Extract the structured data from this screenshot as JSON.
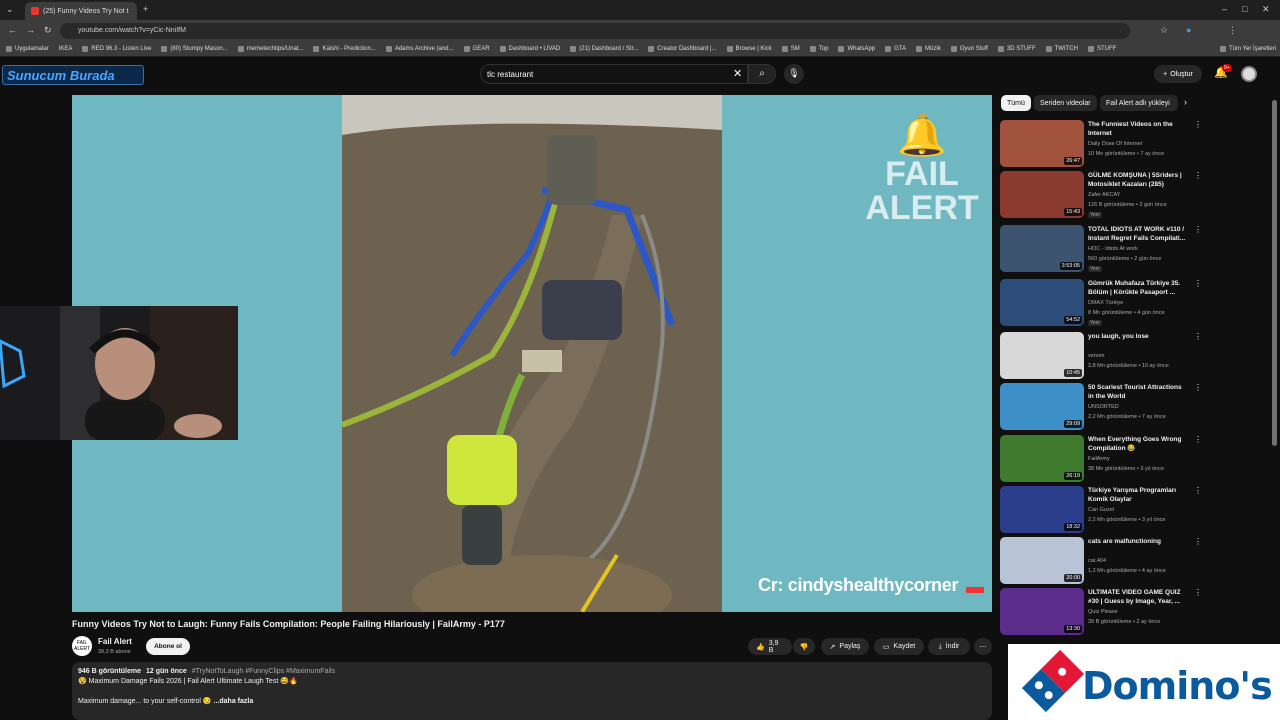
{
  "browser": {
    "tab_title": "(25) Funny Videos Try Not t",
    "url": "youtube.com/watch?v=yCic-NniIfM",
    "bookmarks": [
      "Uygulamalar",
      "IKEA",
      "RED 96.3 - Listen Live",
      "(80) Stumpy Mason...",
      "memetechtips/Unat...",
      "Kaishi - Prediction...",
      "Adams Archive (and...",
      "GEAR",
      "Dashboard • LIVAD",
      "(21) Dashboard / Str...",
      "Creator Dashboard |...",
      "Browse | Kick",
      "SM",
      "Top",
      "WhatsApp",
      "GTA",
      "Müzik",
      "Oyun Stuff",
      "3D STUFF",
      "TWITCH",
      "STUFF"
    ],
    "other_bookmarks": "Tüm Yer İşaretleri"
  },
  "header": {
    "logo_text": "Sunucum Burada",
    "search_value": "tlc restaurant",
    "create_label": "Oluştur",
    "notification_count": "9+"
  },
  "player": {
    "watermark_line1": "FAIL",
    "watermark_line2": "ALERT",
    "credit": "Cr: cindyshealthycorner"
  },
  "video": {
    "title": "Funny Videos Try Not to Laugh: Funny Fails Compilation: People Failing Hilariously | FailArmy - P177",
    "channel": "Fail Alert",
    "channel_avatar_text": "FAIL ALERT",
    "subscribers": "39,3 B abone",
    "subscribe_label": "Abone ol",
    "likes": "3,9 B",
    "share_label": "Paylaş",
    "save_label": "Kaydet",
    "download_label": "İndir",
    "views": "946 B görüntüleme",
    "age": "12 gün önce",
    "hashtags": "#TryNotToLaugh #FunnyClips #MaximumFails",
    "desc_line1": "Maximum Damage Fails 2026 | Fail Alert Ultimate Laugh Test",
    "desc_line2": "Maximum damage... to your self-control",
    "more_label": "...daha fazla"
  },
  "sidebar": {
    "chips": [
      "Tümü",
      "Seriden videolar",
      "Fail Alert adlı yükleyi"
    ],
    "recommendations": [
      {
        "title": "The Funniest Videos on the Internet",
        "channel": "Daily Dose Of Internet",
        "meta": "10 Mn görüntüleme • 7 ay önce",
        "duration": "26:47",
        "new": ""
      },
      {
        "title": "GÜLME KOMŞUNA | 5Sriders | Motosiklet Kazaları (285)",
        "channel": "Zafer AKCAY",
        "meta": "126 B görüntüleme • 2 gün önce",
        "duration": "15:43",
        "new": "Yeni"
      },
      {
        "title": "TOTAL IDIOTS AT WORK #110 / Instant Regret Fails Compilati...",
        "channel": "HOC - Idiots At work",
        "meta": "560 görüntüleme • 2 gün önce",
        "duration": "3:53:05",
        "new": "Yeni"
      },
      {
        "title": "Gümrük Muhafaza Türkiye 35. Bölüm | Körükte Pasaport ...",
        "channel": "DMAX Türkiye",
        "meta": "8 Mn görüntüleme • 4 gün önce",
        "duration": "54:52",
        "new": "Yeni"
      },
      {
        "title": "you laugh, you lose",
        "channel": "venom",
        "meta": "2,8 Mn görüntüleme • 10 ay önce",
        "duration": "10:45",
        "new": ""
      },
      {
        "title": "50 Scariest Tourist Attractions in the World",
        "channel": "UNSORTED",
        "meta": "2,2 Mn görüntüleme • 7 ay önce",
        "duration": "29:09",
        "new": ""
      },
      {
        "title": "When Everything Goes Wrong Compilation 😂",
        "channel": "FailArmy",
        "meta": "38 Mn görüntüleme • 3 yıl önce",
        "duration": "26:19",
        "new": ""
      },
      {
        "title": "Türkiye Yarışma Programları Komik Olaylar",
        "channel": "Can Guzel",
        "meta": "2,2 Mn görüntüleme • 3 yıl önce",
        "duration": "18:32",
        "new": ""
      },
      {
        "title": "cats are malfunctioning",
        "channel": "cat.404",
        "meta": "1,2 Mn görüntüleme • 4 ay önce",
        "duration": "20:00",
        "new": ""
      },
      {
        "title": "ULTIMATE VIDEO GAME QUIZ #30 | Guess by Image, Year, ...",
        "channel": "Quiz Please",
        "meta": "39 B görüntüleme • 2 ay önce",
        "duration": "13:30",
        "new": ""
      }
    ]
  },
  "ad": {
    "brand": "Domino's"
  },
  "colors": {
    "player_bg": "#6fb8c2",
    "brand_blue": "#0b5a9d",
    "domino_red": "#e31837",
    "bg": "#0f0f0f"
  }
}
